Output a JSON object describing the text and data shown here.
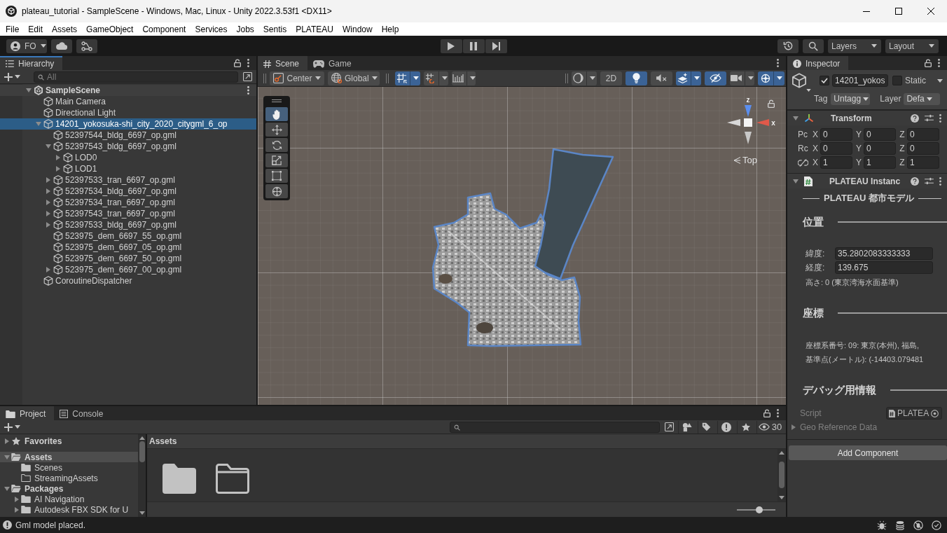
{
  "window": {
    "title": "plateau_tutorial - SampleScene - Windows, Mac, Linux - Unity 2022.3.53f1 <DX11>"
  },
  "menu": [
    "File",
    "Edit",
    "Assets",
    "GameObject",
    "Component",
    "Services",
    "Jobs",
    "Sentis",
    "PLATEAU",
    "Window",
    "Help"
  ],
  "toolbar": {
    "account": "FO",
    "layers": "Layers",
    "layout": "Layout"
  },
  "hierarchy": {
    "tab": "Hierarchy",
    "focused": true,
    "search": {
      "placeholder": "All"
    },
    "tree": [
      {
        "label": "SampleScene",
        "kind": "scene",
        "expanded": true,
        "selected": false,
        "children": [
          {
            "label": "Main Camera",
            "kind": "object",
            "selected": false
          },
          {
            "label": "Directional Light",
            "kind": "object",
            "selected": false
          },
          {
            "label": "14201_yokosuka-shi_city_2020_citygml_6_op",
            "kind": "object",
            "expanded": true,
            "selected": true,
            "children": [
              {
                "label": "52397544_bldg_6697_op.gml",
                "kind": "object",
                "selected": false
              },
              {
                "label": "52397543_bldg_6697_op.gml",
                "kind": "object",
                "expanded": true,
                "selected": false,
                "children": [
                  {
                    "label": "LOD0",
                    "kind": "object",
                    "expanded": false,
                    "selected": false
                  },
                  {
                    "label": "LOD1",
                    "kind": "object",
                    "expanded": false,
                    "selected": false
                  }
                ]
              },
              {
                "label": "52397533_tran_6697_op.gml",
                "kind": "object",
                "expanded": false,
                "selected": false
              },
              {
                "label": "52397534_bldg_6697_op.gml",
                "kind": "object",
                "expanded": false,
                "selected": false
              },
              {
                "label": "52397534_tran_6697_op.gml",
                "kind": "object",
                "expanded": false,
                "selected": false
              },
              {
                "label": "52397543_tran_6697_op.gml",
                "kind": "object",
                "expanded": false,
                "selected": false
              },
              {
                "label": "52397533_bldg_6697_op.gml",
                "kind": "object",
                "expanded": false,
                "selected": false
              },
              {
                "label": "523975_dem_6697_55_op.gml",
                "kind": "object",
                "selected": false
              },
              {
                "label": "523975_dem_6697_05_op.gml",
                "kind": "object",
                "selected": false
              },
              {
                "label": "523975_dem_6697_50_op.gml",
                "kind": "object",
                "selected": false
              },
              {
                "label": "523975_dem_6697_00_op.gml",
                "kind": "object",
                "expanded": false,
                "selected": false
              }
            ]
          },
          {
            "label": "CoroutineDispatcher",
            "kind": "object",
            "selected": false
          }
        ]
      }
    ]
  },
  "scene_view": {
    "focused": false,
    "tabs": [
      {
        "label": "Scene",
        "kind": "scene",
        "selected": true
      },
      {
        "label": "Game",
        "kind": "game",
        "selected": false
      }
    ],
    "toolbar": {
      "pivot": "Center",
      "space": "Global",
      "snapping": [
        {
          "on": true,
          "menu": true
        },
        {
          "on": false,
          "menu": true
        },
        {
          "on": false,
          "menu": true
        }
      ],
      "view_options": [
        {
          "kind": "icon",
          "on": false,
          "menu": true
        },
        {
          "kind": "text",
          "label": "2D",
          "on": false,
          "menu": false
        },
        {
          "kind": "icon",
          "on": true,
          "menu": false
        },
        {
          "kind": "icon",
          "on": false,
          "menu": false
        },
        {
          "kind": "icon",
          "on": true,
          "menu": true
        },
        {
          "kind": "icon",
          "on": true,
          "menu": false
        },
        {
          "kind": "icon",
          "on": false,
          "menu": true
        },
        {
          "kind": "icon",
          "on": true,
          "menu": true
        }
      ]
    },
    "tools": [
      {
        "selected": true
      },
      {
        "selected": false
      },
      {
        "selected": false
      },
      {
        "selected": false
      },
      {
        "selected": false
      },
      {
        "selected": false
      }
    ],
    "gizmo": {
      "z_label": "z",
      "x_label": "x",
      "view": "Top"
    }
  },
  "inspector": {
    "tab": "Inspector",
    "focused": false,
    "object": {
      "active": true,
      "name": "14201_yokos",
      "static": false,
      "static_label": "Static",
      "tag_label": "Tag",
      "tag": "Untagg",
      "layer_label": "Layer",
      "layer": "Defa"
    },
    "components": [
      {
        "kind": "transform",
        "title": "Transform",
        "expanded": true,
        "rows": [
          {
            "kind": "label",
            "label": "Pc",
            "values": [
              {
                "axis": "X",
                "value": "0"
              },
              {
                "axis": "Y",
                "value": "0"
              },
              {
                "axis": "Z",
                "value": "0"
              }
            ]
          },
          {
            "kind": "label",
            "label": "Rc",
            "values": [
              {
                "axis": "X",
                "value": "0"
              },
              {
                "axis": "Y",
                "value": "0"
              },
              {
                "axis": "Z",
                "value": "0"
              }
            ]
          },
          {
            "kind": "link",
            "values": [
              {
                "axis": "X",
                "value": "1"
              },
              {
                "axis": "Y",
                "value": "1"
              },
              {
                "axis": "Z",
                "value": "1"
              }
            ]
          }
        ]
      },
      {
        "kind": "script",
        "title": "PLATEAU Instanc",
        "expanded": true,
        "banner": "PLATEAU 都市モデル",
        "sections": [
          {
            "heading": "位置",
            "items": [
              {
                "kind": "field",
                "label": "緯度:",
                "value": "35.2802083333333"
              },
              {
                "kind": "field",
                "label": "経度:",
                "value": "139.675"
              },
              {
                "kind": "text",
                "text": "高さ: 0 (東京湾海水面基準)"
              }
            ]
          },
          {
            "heading": "座標",
            "items": [
              {
                "kind": "text",
                "text": "座標系番号: 09: 東京(本州), 福島,"
              },
              {
                "kind": "text",
                "text": "基準点(メートル): (-14403.079481"
              }
            ]
          },
          {
            "heading": "デバッグ用情報",
            "items": [
              {
                "kind": "object",
                "label": "Script",
                "value": "PLATEA",
                "disabled": true
              },
              {
                "kind": "foldout",
                "label": "Geo Reference Data",
                "expanded": false,
                "disabled": true
              }
            ]
          }
        ]
      }
    ],
    "add_component": "Add Component"
  },
  "project": {
    "focused": false,
    "tabs": [
      {
        "label": "Project",
        "kind": "project",
        "selected": true
      },
      {
        "label": "Console",
        "kind": "console",
        "selected": false
      }
    ],
    "hidden_count": "30",
    "tree": [
      {
        "label": "Favorites",
        "kind": "favorites",
        "expanded": false,
        "selected": false
      },
      {
        "label": "Assets",
        "kind": "folder",
        "expanded": true,
        "selected": true,
        "children": [
          {
            "label": "Scenes",
            "kind": "folder",
            "selected": false
          },
          {
            "label": "StreamingAssets",
            "kind": "empty-folder",
            "selected": false
          }
        ]
      },
      {
        "label": "Packages",
        "kind": "folder",
        "expanded": true,
        "selected": false,
        "children": [
          {
            "label": "AI Navigation",
            "kind": "folder",
            "expanded": false,
            "selected": false
          },
          {
            "label": "Autodesk FBX SDK for U",
            "kind": "folder",
            "expanded": false,
            "selected": false
          }
        ]
      }
    ],
    "breadcrumb": "Assets",
    "items": [
      {
        "kind": "folder"
      },
      {
        "kind": "empty-folder"
      }
    ],
    "icon_size": {
      "level": 0.58
    }
  },
  "status_bar": {
    "message": "Gml model placed."
  }
}
